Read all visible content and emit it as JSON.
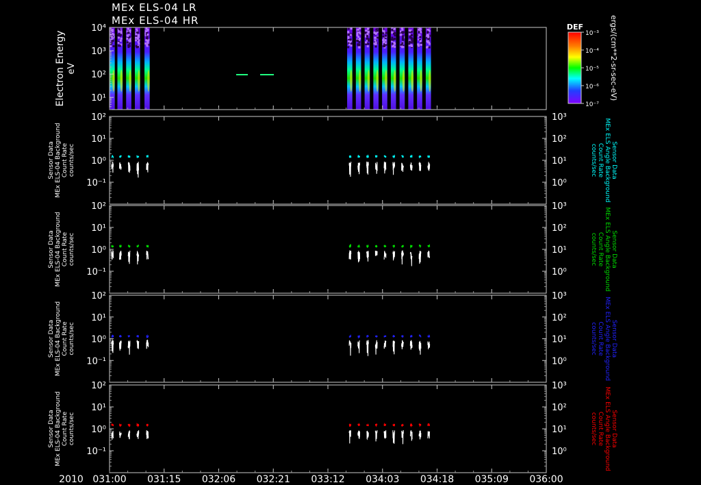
{
  "header": {
    "line1": "MEx ELS-04 LR",
    "line2": "MEx ELS-04 HR"
  },
  "colorbar": {
    "title": "DEF",
    "tick_labels": [
      "10⁻³",
      "10⁻⁴",
      "10⁻⁵",
      "10⁻⁶",
      "10⁻⁷"
    ],
    "unit_label": "ergs/(cm**2-sr-sec-eV)"
  },
  "chart_data": [
    {
      "type": "heatmap",
      "ylabel": "Electron Energy",
      "yunit": "eV",
      "y_tick_labels": [
        "10⁴",
        "10³",
        "10²",
        "10¹"
      ],
      "ylim": [
        3,
        10000
      ],
      "scale": "log",
      "data_segments_doy": [
        [
          31.0,
          31.06
        ],
        [
          31.09,
          31.15
        ],
        [
          31.19,
          31.25
        ],
        [
          31.29,
          31.35
        ],
        [
          31.4,
          31.46
        ],
        [
          33.72,
          33.78
        ],
        [
          33.82,
          33.88
        ],
        [
          33.92,
          33.98
        ],
        [
          34.02,
          34.08
        ],
        [
          34.12,
          34.18
        ],
        [
          34.22,
          34.28
        ],
        [
          34.32,
          34.38
        ],
        [
          34.42,
          34.48
        ],
        [
          34.52,
          34.58
        ],
        [
          34.62,
          34.68
        ]
      ],
      "colorbar_range": [
        1e-07,
        0.001
      ]
    },
    {
      "type": "line",
      "ylabel_lines": [
        "Sensor Data",
        "MEx ELS-04 Background",
        "Count Rate",
        "counts/sec"
      ],
      "right_label_lines": [
        "Sensor Data",
        "MEx ELS Angle Background",
        "Count Rate",
        "counts/sec"
      ],
      "left_ticks": [
        "10²",
        "10¹",
        "10⁰",
        "10⁻¹"
      ],
      "right_ticks": [
        "10³",
        "10²",
        "10¹",
        "10⁰"
      ],
      "ylim": [
        0.01,
        100
      ],
      "series": [
        {
          "name": "",
          "color": "#00ffff",
          "level": 1.5
        },
        {
          "name": "",
          "color": "#ffffff",
          "level": 0.6
        }
      ]
    },
    {
      "type": "line",
      "ylabel_lines": [
        "Sensor Data",
        "MEx ELS-04 Background",
        "Count Rate",
        "counts/sec"
      ],
      "right_label_lines": [
        "Sensor Data",
        "MEx ELS Angle Background",
        "Count Rate",
        "counts/sec"
      ],
      "left_ticks": [
        "10²",
        "10¹",
        "10⁰",
        "10⁻¹"
      ],
      "right_ticks": [
        "10³",
        "10²",
        "10¹",
        "10⁰"
      ],
      "ylim": [
        0.01,
        100
      ],
      "series": [
        {
          "name": "",
          "color": "#00dd00",
          "level": 1.4
        },
        {
          "name": "",
          "color": "#ffffff",
          "level": 0.6
        }
      ]
    },
    {
      "type": "line",
      "ylabel_lines": [
        "Sensor Data",
        "MEx ELS-04 Background",
        "Count Rate",
        "counts/sec"
      ],
      "right_label_lines": [
        "Sensor Data",
        "MEx ELS Angle Background",
        "Count Rate",
        "counts/sec"
      ],
      "left_ticks": [
        "10²",
        "10¹",
        "10⁰",
        "10⁻¹"
      ],
      "right_ticks": [
        "10³",
        "10²",
        "10¹",
        "10⁰"
      ],
      "ylim": [
        0.01,
        100
      ],
      "series": [
        {
          "name": "",
          "color": "#2222ff",
          "level": 1.3
        },
        {
          "name": "",
          "color": "#ffffff",
          "level": 0.6
        }
      ]
    },
    {
      "type": "line",
      "ylabel_lines": [
        "Sensor Data",
        "MEx ELS-04 Background",
        "Count Rate",
        "counts/sec"
      ],
      "right_label_lines": [
        "Sensor Data",
        "MEx ELS Angle Background",
        "Count Rate",
        "counts/sec"
      ],
      "left_ticks": [
        "10²",
        "10¹",
        "10⁰",
        "10⁻¹"
      ],
      "right_ticks": [
        "10³",
        "10²",
        "10¹",
        "10⁰"
      ],
      "ylim": [
        0.01,
        100
      ],
      "series": [
        {
          "name": "",
          "color": "#ff0000",
          "level": 1.5
        },
        {
          "name": "",
          "color": "#ffffff",
          "level": 0.6
        }
      ]
    }
  ],
  "x_axis": {
    "year_label": "2010",
    "tick_labels": [
      "031:00",
      "031:15",
      "032:06",
      "032:21",
      "033:12",
      "034:03",
      "034:18",
      "035:09",
      "036:00"
    ],
    "range_doy": [
      31.0,
      36.0
    ]
  }
}
